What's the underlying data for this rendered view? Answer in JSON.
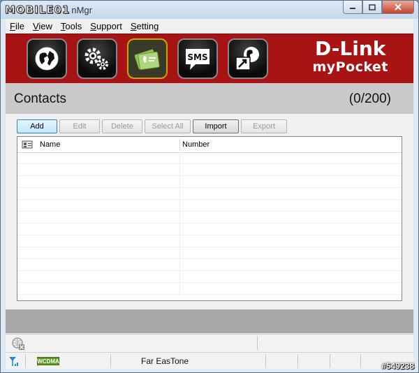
{
  "window": {
    "title_logo": "MOBILE01",
    "title_rest": "nMgr",
    "minimize_icon": "minimize-icon",
    "maximize_icon": "maximize-icon",
    "close_icon": "close-icon"
  },
  "menu": {
    "items": [
      {
        "key": "F",
        "rest": "ile"
      },
      {
        "key": "V",
        "rest": "iew"
      },
      {
        "key": "T",
        "rest": "ools"
      },
      {
        "key": "S",
        "rest": "upport"
      },
      {
        "key": "S",
        "rest": "etting"
      }
    ]
  },
  "toolbar": {
    "buttons": [
      {
        "icon": "globe-icon"
      },
      {
        "icon": "settings-gears-icon"
      },
      {
        "icon": "contacts-phonebook-icon",
        "active": true
      },
      {
        "icon": "sms-icon",
        "label": "SMS"
      },
      {
        "icon": "network-globe-arrow-icon"
      }
    ],
    "brand_top": "D-Link",
    "brand_bottom": "myPocket",
    "brand_color": "#a81414"
  },
  "header": {
    "title": "Contacts",
    "count": "(0/200)"
  },
  "actions": {
    "add": "Add",
    "edit": "Edit",
    "delete": "Delete",
    "select_all": "Select All",
    "import": "Import",
    "export": "Export"
  },
  "table": {
    "header_icon": "contact-card-icon",
    "columns": [
      "Name",
      "Number"
    ],
    "rows": []
  },
  "status": {
    "network_icon": "network-disconnected-icon",
    "signal_icon": "signal-antenna-icon",
    "network_type": "WCDMA",
    "operator": "Far EasTone"
  },
  "watermark": "#549238"
}
